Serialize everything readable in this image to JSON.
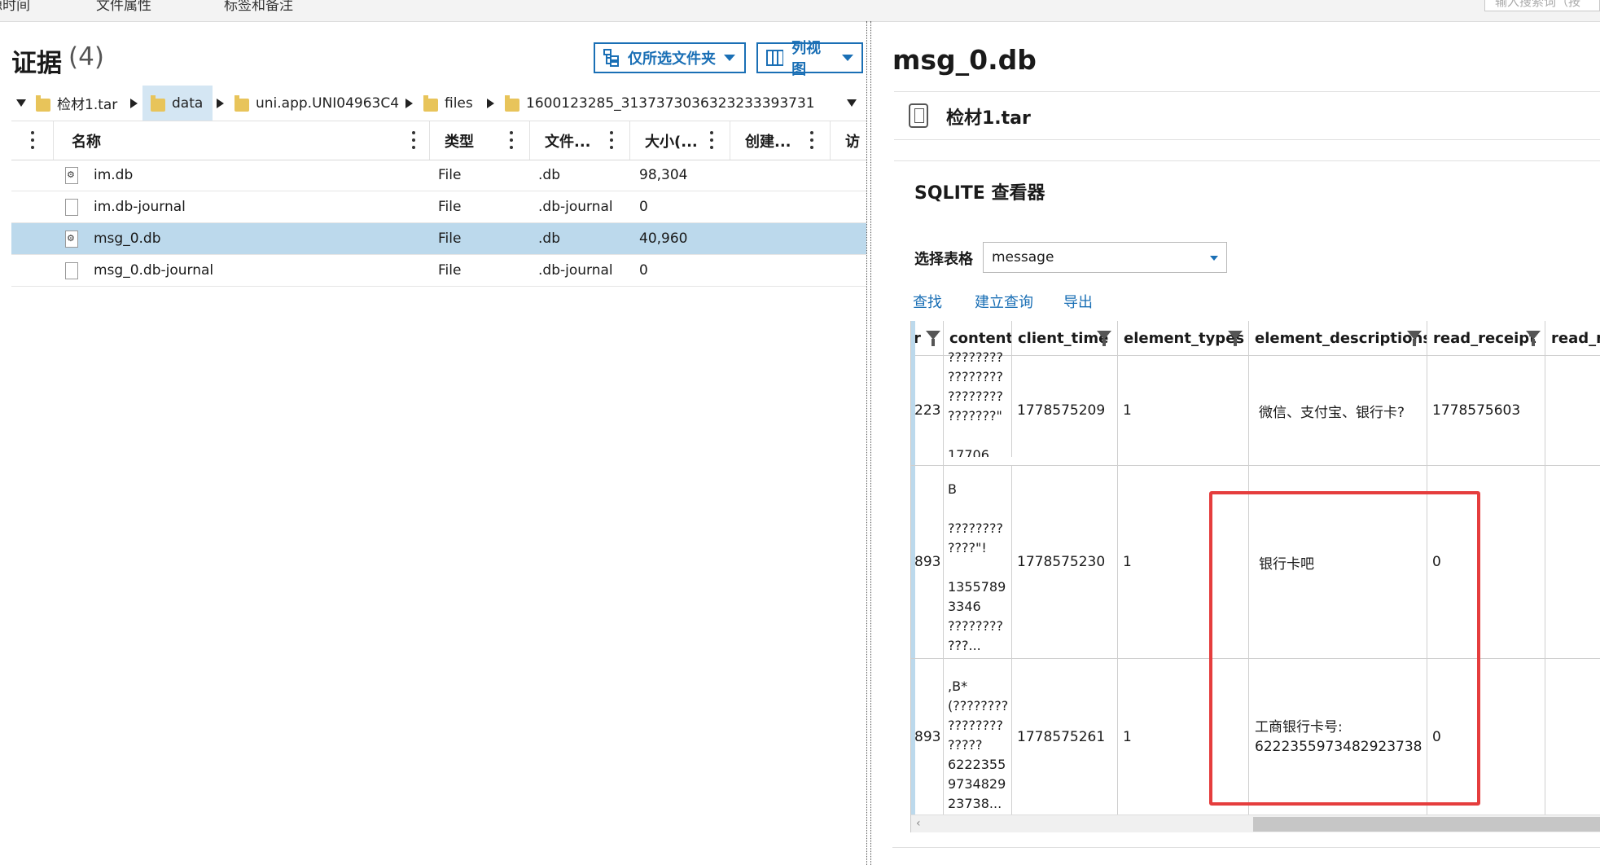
{
  "topbar": {
    "items": [
      "源时间",
      "文件属性",
      "标签和备注"
    ],
    "input_hint": "输入搜索词（按"
  },
  "evidence": {
    "title": "证据",
    "count": "(4)",
    "btn_folder": "仅所选文件夹",
    "btn_view": "列视图",
    "breadcrumb": [
      "检材1.tar",
      "data",
      "uni.app.UNI04963C4",
      "files",
      "1600123285_3137373036323233393731"
    ],
    "columns": [
      "名称",
      "类型",
      "文件...",
      "大小(...",
      "创建...",
      "访"
    ],
    "files": [
      {
        "name": "im.db",
        "type": "File",
        "ext": ".db",
        "size": "98,304",
        "icon": "db-file-icon",
        "selected": false
      },
      {
        "name": "im.db-journal",
        "type": "File",
        "ext": ".db-journal",
        "size": "0",
        "icon": "blank-file-icon",
        "selected": false
      },
      {
        "name": "msg_0.db",
        "type": "File",
        "ext": ".db",
        "size": "40,960",
        "icon": "db-file-icon",
        "selected": true
      },
      {
        "name": "msg_0.db-journal",
        "type": "File",
        "ext": ".db-journal",
        "size": "0",
        "icon": "blank-file-icon",
        "selected": false
      }
    ]
  },
  "detail": {
    "title": "msg_0.db",
    "source": "检材1.tar",
    "viewer_title": "SQLITE 查看器",
    "table_label": "选择表格",
    "table_value": "message",
    "links": [
      "查找",
      "建立查询",
      "导出"
    ],
    "columns": [
      "r",
      "content",
      "client_time",
      "element_types",
      "element_descriptions",
      "read_receipt",
      "read_m"
    ],
    "rows": [
      {
        "r": "223",
        "content": "????????\n????????\n????????\n???????\"\n\n17706...",
        "client_time": "1778575209",
        "element_types": "1",
        "element_descriptions": "微信、支付宝、银行卡?",
        "read_receipt": "1778575603"
      },
      {
        "r": "893",
        "content": "B\n\n????????\n????\"!\n\n1355789\n3346\n????????\n???...",
        "client_time": "1778575230",
        "element_types": "1",
        "element_descriptions": "银行卡吧",
        "read_receipt": "0"
      },
      {
        "r": "893",
        "content": ",B*\n(????????\n????????\n?????\n6222355\n9734829\n23738...",
        "client_time": "1778575261",
        "element_types": "1",
        "element_descriptions": "工商银行卡号:\n6222355973482923738",
        "read_receipt": "0"
      }
    ]
  },
  "colors": {
    "accent": "#1a6fb5",
    "selection": "#bcd9ec",
    "highlight": "#e53d3d"
  }
}
